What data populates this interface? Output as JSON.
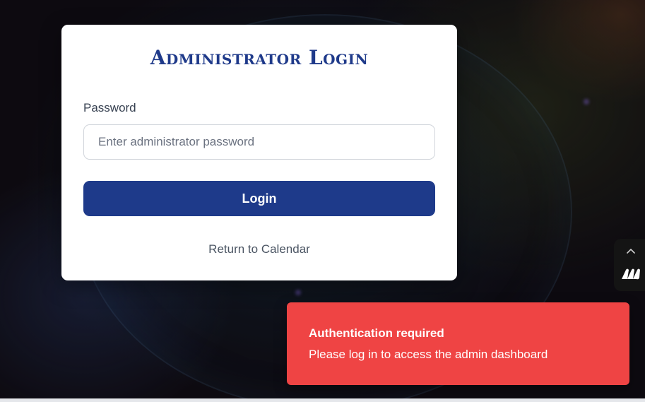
{
  "login": {
    "title": "Administrator Login",
    "password_label": "Password",
    "password_placeholder": "Enter administrator password",
    "password_value": "",
    "login_button": "Login",
    "return_link": "Return to Calendar"
  },
  "side_widget": {
    "icons": [
      "chevron-up-icon",
      "brand-logo-icon"
    ]
  },
  "toast": {
    "title": "Authentication required",
    "message": "Please log in to access the admin dashboard"
  },
  "colors": {
    "accent": "#1e3a8a",
    "title": "#1f3a8a",
    "toast_bg": "#ef4444",
    "card_bg": "#ffffff",
    "page_bg": "#0d0a10"
  }
}
